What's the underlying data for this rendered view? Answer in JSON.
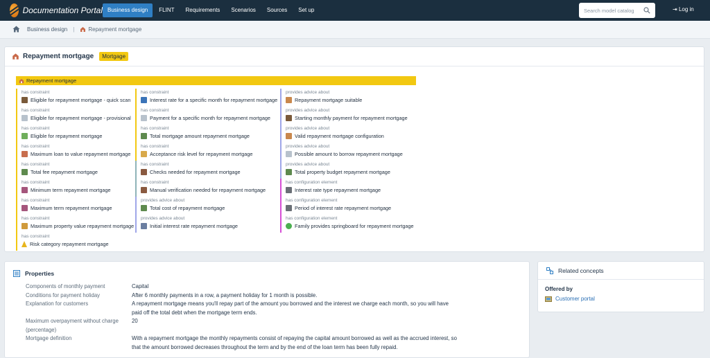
{
  "app": {
    "title": "Documentation Portal"
  },
  "nav": {
    "items": [
      "Business design",
      "FLINT",
      "Requirements",
      "Scenarios",
      "Sources",
      "Set up"
    ],
    "search_placeholder": "Search model catalog",
    "login_label": "Log in"
  },
  "breadcrumb": {
    "home": "Business design",
    "current": "Repayment mortgage"
  },
  "concept": {
    "title": "Repayment mortgage",
    "badge": "Mortgage",
    "bar_label": "Repayment mortgage",
    "col1": [
      {
        "kind": "has constraint",
        "target": "Eligible for repayment mortgage - quick scan",
        "icon": "gavel-icon"
      },
      {
        "kind": "has constraint",
        "target": "Eligible for repayment mortgage - provisional",
        "icon": "document-icon"
      },
      {
        "kind": "has constraint",
        "target": "Eligible for repayment mortgage",
        "icon": "check-document-icon"
      },
      {
        "kind": "has constraint",
        "target": "Maximum loan to value repayment mortgage",
        "icon": "house-chart-icon"
      },
      {
        "kind": "has constraint",
        "target": "Total fee repayment mortgage",
        "icon": "calculator-icon"
      },
      {
        "kind": "has constraint",
        "target": "Minimum term repayment mortgage",
        "icon": "calendar-icon"
      },
      {
        "kind": "has constraint",
        "target": "Maximum term repayment mortgage",
        "icon": "calendar-icon"
      },
      {
        "kind": "has constraint",
        "target": "Maximum property value repayment mortgage",
        "icon": "hand-money-icon"
      },
      {
        "kind": "has constraint",
        "target": "Risk category repayment mortgage",
        "icon": "warning-icon"
      }
    ],
    "col2": [
      {
        "kind": "has constraint",
        "target": "Interest rate for a specific month for repayment mortgage",
        "icon": "person-chart-icon",
        "style": "yellow"
      },
      {
        "kind": "has constraint",
        "target": "Payment for a specific month for repayment mortgage",
        "icon": "document-icon",
        "style": "yellow"
      },
      {
        "kind": "has constraint",
        "target": "Total mortgage amount repayment mortgage",
        "icon": "calculator-icon",
        "style": "yellow"
      },
      {
        "kind": "has constraint",
        "target": "Acceptance risk level for repayment mortgage",
        "icon": "handshake-icon",
        "style": "yellow"
      },
      {
        "kind": "has constraint",
        "target": "Checks needed for repayment mortgage",
        "icon": "person-icon",
        "style": "teal"
      },
      {
        "kind": "has constraint",
        "target": "Manual verification needed for repayment mortgage",
        "icon": "person-icon",
        "style": "teal"
      },
      {
        "kind": "provides advice about",
        "target": "Total cost of repayment mortgage",
        "icon": "calculator-icon",
        "style": "purple"
      },
      {
        "kind": "provides advice about",
        "target": "Initial interest rate repayment mortgage",
        "icon": "percent-icon",
        "style": "purple"
      }
    ],
    "col3": [
      {
        "kind": "provides advice about",
        "target": "Repayment mortgage suitable",
        "icon": "house-hand-icon",
        "style": "purple"
      },
      {
        "kind": "provides advice about",
        "target": "Starting monthly payment for repayment mortgage",
        "icon": "gavel-icon",
        "style": "purple"
      },
      {
        "kind": "provides advice about",
        "target": "Valid repayment mortgage configuration",
        "icon": "house-hand-icon",
        "style": "purple"
      },
      {
        "kind": "provides advice about",
        "target": "Possible amount to borrow repayment mortgage",
        "icon": "document-icon",
        "style": "purple"
      },
      {
        "kind": "provides advice about",
        "target": "Total property budget repayment mortgage",
        "icon": "calculator-icon",
        "style": "purple"
      },
      {
        "kind": "has configuration element",
        "target": "Interest rate type repayment mortgage",
        "icon": "phone-icon",
        "style": "pink"
      },
      {
        "kind": "has configuration element",
        "target": "Period of interest rate repayment mortgage",
        "icon": "phone-icon",
        "style": "pink"
      },
      {
        "kind": "has configuration element",
        "target": "Family provides springboard for repayment mortgage",
        "icon": "circle-icon",
        "style": "pink"
      }
    ]
  },
  "properties": {
    "title": "Properties",
    "rows": [
      {
        "key": "Components of monthly payment",
        "value": "Capital"
      },
      {
        "key": "Conditions for payment holiday",
        "value": "After 6 monthly payments in a row, a payment holiday for 1 month is possible."
      },
      {
        "key": "Explanation for customers",
        "value": "A repayment mortgage means you'll repay part of the amount you borrowed and the interest we charge each month, so you will have paid off the total debt when the mortgage term ends."
      },
      {
        "key": "Maximum overpayment without charge (percentage)",
        "value": "20"
      },
      {
        "key": "Mortgage definition",
        "value": "With a repayment mortgage the monthly repayments consist of repaying the capital amount borrowed as well as the accrued interest, so that the amount borrowed decreases throughout the term and by the end of the loan term has been fully repaid."
      }
    ]
  },
  "related": {
    "title": "Related concepts",
    "offered_by_label": "Offered by",
    "offered_by": "Customer portal"
  },
  "colors": {
    "nav_bg": "#1b2f3f",
    "accent_blue": "#2f7fc4",
    "brand_yellow": "#f2c811",
    "advice_purple": "#9fa6e8",
    "config_pink": "#d64fd6"
  }
}
